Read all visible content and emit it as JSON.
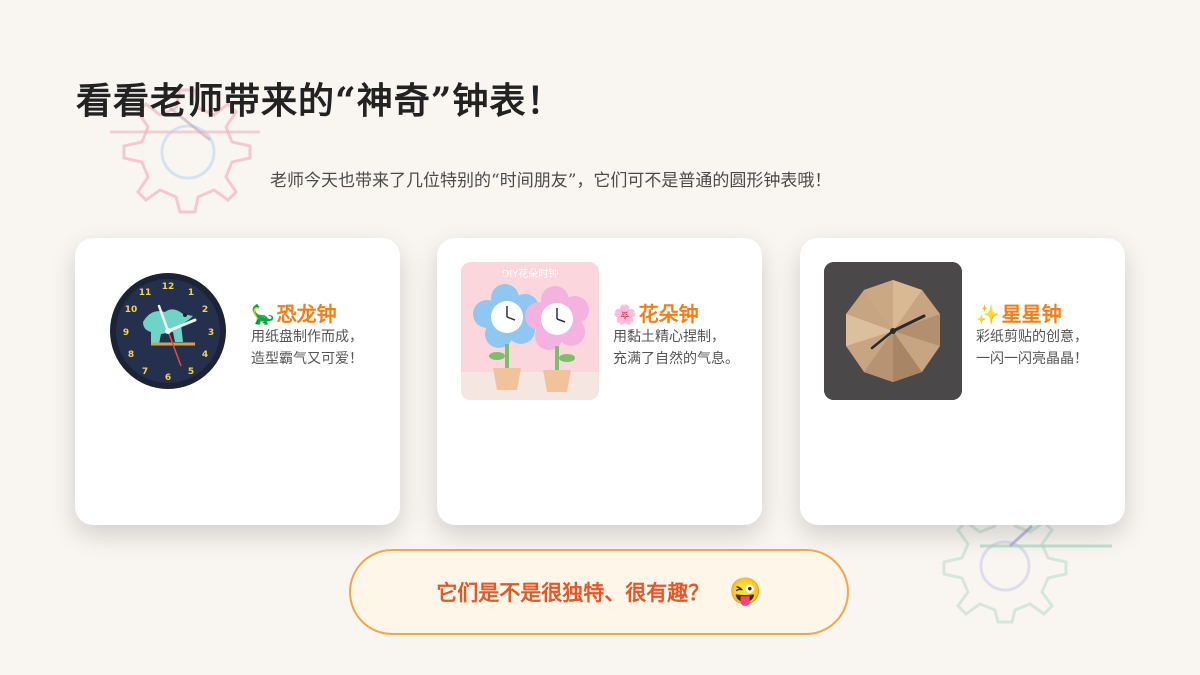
{
  "title": "看看老师带来的“神奇”钟表！",
  "subtitle": "老师今天也带来了几位特别的“时间朋友”，它们可不是普通的圆形钟表哦！",
  "cards": [
    {
      "emoji": "🦕",
      "name": "恐龙钟",
      "line1": "用纸盘制作而成，",
      "line2": "造型霸气又可爱！",
      "image_icon": "dinosaur-clock-image"
    },
    {
      "emoji": "🌸",
      "name": "花朵钟",
      "line1": "用黏土精心捏制，",
      "line2": "充满了自然的气息。",
      "image_icon": "flower-clock-image",
      "image_banner": "DIY花朵时钟"
    },
    {
      "emoji": "✨",
      "name": "星星钟",
      "line1": "彩纸剪贴的创意，",
      "line2": "一闪一闪亮晶晶！",
      "image_icon": "star-clock-image"
    }
  ],
  "bottom": {
    "question": "它们是不是很独特、很有趣？",
    "emoji": "😜"
  },
  "colors": {
    "background": "#f9f6f2",
    "accent_orange": "#f07f1a",
    "question_red": "#e0592a",
    "pill_border": "#f2a64a"
  }
}
